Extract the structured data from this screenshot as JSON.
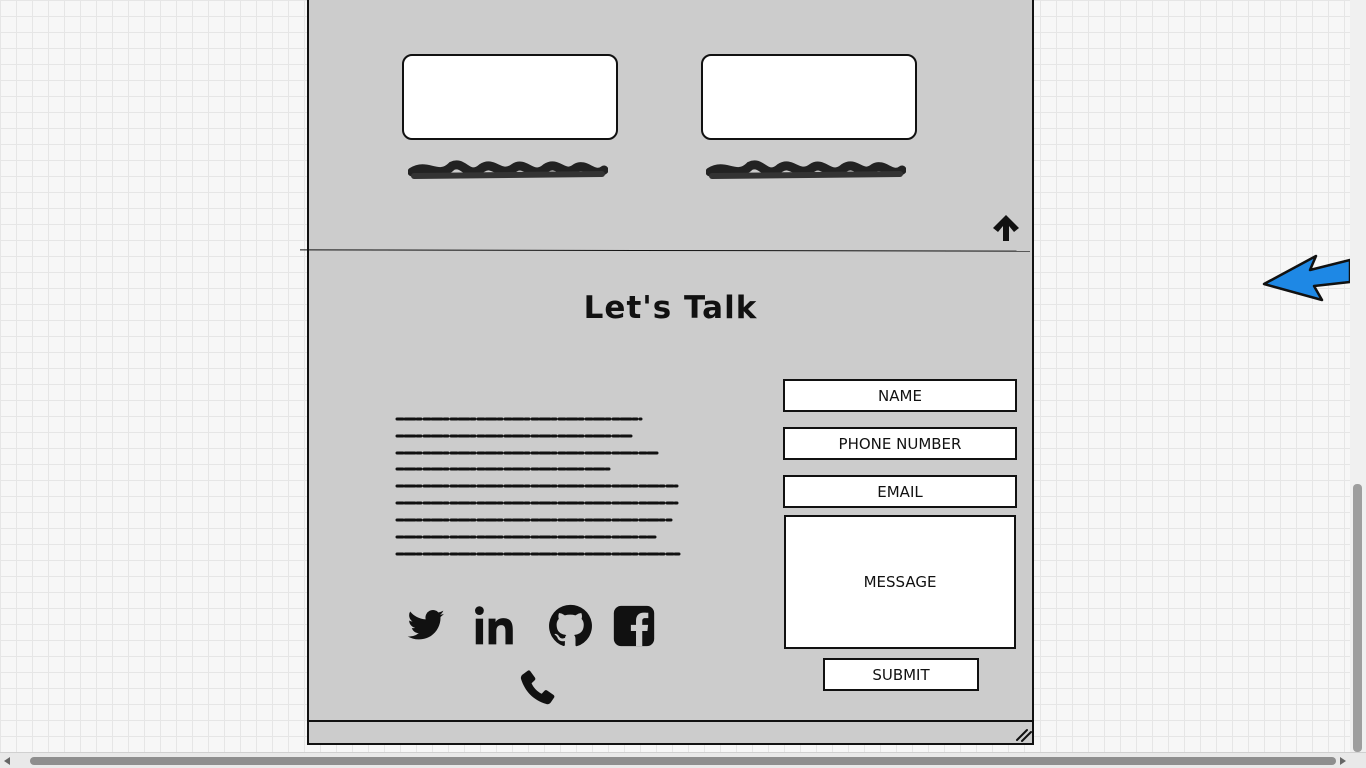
{
  "contact": {
    "heading": "Let's Talk",
    "form": {
      "name_label": "NAME",
      "phone_label": "PHONE NUMBER",
      "email_label": "EMAIL",
      "message_label": "MESSAGE",
      "submit_label": "SUBMIT"
    },
    "social_icons": [
      "twitter-icon",
      "linkedin-icon",
      "github-icon",
      "facebook-icon",
      "phone-icon"
    ]
  },
  "colors": {
    "panel_bg": "#cccccc",
    "canvas_bg": "#f7f7f7",
    "accent_arrow": "#1e88e5",
    "ink": "#111111"
  },
  "icons": {
    "back_to_top": "arrow-up-icon",
    "annotation": "blue-arrow-icon",
    "resize": "resize-handle-icon"
  }
}
